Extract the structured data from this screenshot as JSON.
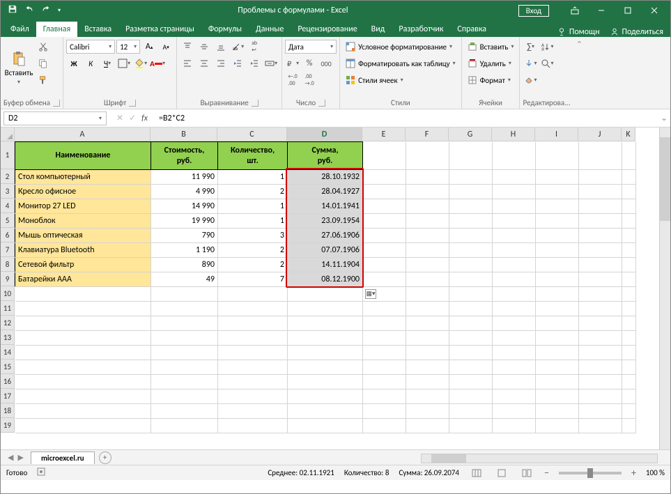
{
  "title": "Проблемы с формулами  -  Excel",
  "signin": "Вход",
  "tabs": [
    "Файл",
    "Главная",
    "Вставка",
    "Разметка страницы",
    "Формулы",
    "Данные",
    "Рецензирование",
    "Вид",
    "Разработчик",
    "Справка"
  ],
  "active_tab": 1,
  "help_hint": "Помощн",
  "share": "Поделиться",
  "ribbon": {
    "clipboard": {
      "paste": "Вставить",
      "label": "Буфер обмена"
    },
    "font": {
      "name": "Calibri",
      "size": "12",
      "label": "Шрифт"
    },
    "align_label": "Выравнивание",
    "number": {
      "format": "Дата",
      "label": "Число"
    },
    "styles": {
      "cond": "Условное форматирование",
      "table": "Форматировать как таблицу",
      "cell": "Стили ячеек",
      "label": "Стили"
    },
    "cells": {
      "insert": "Вставить",
      "delete": "Удалить",
      "format": "Формат",
      "label": "Ячейки"
    },
    "edit_label": "Редактирова..."
  },
  "namebox": "D2",
  "formula": "=B2*C2",
  "cols": [
    {
      "l": "A",
      "w": 195
    },
    {
      "l": "B",
      "w": 96
    },
    {
      "l": "C",
      "w": 100
    },
    {
      "l": "D",
      "w": 108
    },
    {
      "l": "E",
      "w": 62
    },
    {
      "l": "F",
      "w": 62
    },
    {
      "l": "G",
      "w": 62
    },
    {
      "l": "H",
      "w": 62
    },
    {
      "l": "I",
      "w": 62
    },
    {
      "l": "J",
      "w": 62
    },
    {
      "l": "K",
      "w": 20
    }
  ],
  "select_col": 3,
  "header_row": [
    "Наименование",
    "Стоимость, руб.",
    "Количество, шт.",
    "Сумма, руб."
  ],
  "rows": [
    {
      "name": "Стол компьютерный",
      "price": "11 990",
      "qty": "1",
      "sum": "28.10.1932"
    },
    {
      "name": "Кресло офисное",
      "price": "4 990",
      "qty": "2",
      "sum": "28.04.1927"
    },
    {
      "name": "Монитор 27 LED",
      "price": "14 990",
      "qty": "1",
      "sum": "14.01.1941"
    },
    {
      "name": "Моноблок",
      "price": "19 990",
      "qty": "1",
      "sum": "23.09.1954"
    },
    {
      "name": "Мышь оптическая",
      "price": "790",
      "qty": "3",
      "sum": "27.06.1906"
    },
    {
      "name": "Клавиатура Bluetooth",
      "price": "1 190",
      "qty": "2",
      "sum": "07.07.1906"
    },
    {
      "name": "Сетевой фильтр",
      "price": "890",
      "qty": "2",
      "sum": "14.11.1904"
    },
    {
      "name": "Батарейки ААА",
      "price": "49",
      "qty": "7",
      "sum": "08.12.1900"
    }
  ],
  "empty_rows": [
    10,
    11,
    12,
    13,
    14,
    15,
    16,
    17,
    18,
    19
  ],
  "sheet_tab": "microexcel.ru",
  "status": {
    "ready": "Готово",
    "avg": "Среднее: 02.11.1921",
    "count": "Количество: 8",
    "sum": "Сумма: 26.09.2074",
    "zoom": "100 %"
  }
}
